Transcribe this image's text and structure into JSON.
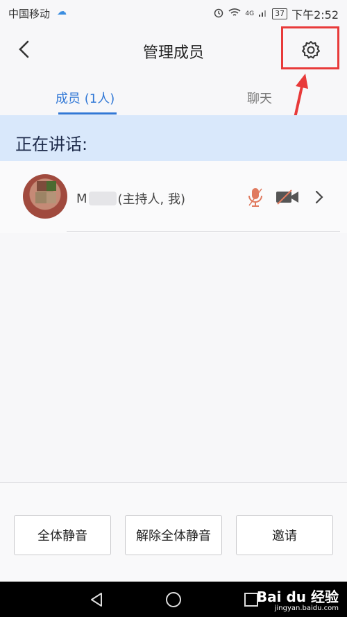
{
  "status_bar": {
    "carrier": "中国移动",
    "signal": "4G",
    "battery": "37",
    "time": "下午2:52"
  },
  "header": {
    "title": "管理成员",
    "back_icon": "chevron-left-icon",
    "settings_icon": "gear-icon",
    "highlight_color": "#e83a3a"
  },
  "tabs": [
    {
      "label": "成员 (1人)",
      "active": true
    },
    {
      "label": "聊天",
      "active": false
    }
  ],
  "speaking_banner": {
    "label": "正在讲话:"
  },
  "members": [
    {
      "name_prefix": "M",
      "name_suffix": "(主持人, 我)",
      "mic_icon": "microphone-muted-icon",
      "camera_icon": "camera-off-icon",
      "chevron_icon": "chevron-right-icon"
    }
  ],
  "actions": {
    "mute_all": "全体静音",
    "unmute_all": "解除全体静音",
    "invite": "邀请"
  },
  "system_nav": {
    "back_icon": "triangle-back-icon",
    "home_icon": "circle-home-icon",
    "recents_icon": "square-recents-icon"
  },
  "watermark": {
    "brand": "Bai du 经验",
    "url": "jingyan.baidu.com"
  },
  "colors": {
    "accent": "#3178d6",
    "banner_bg": "#d9e8fb",
    "muted_red": "#e07a5f"
  }
}
